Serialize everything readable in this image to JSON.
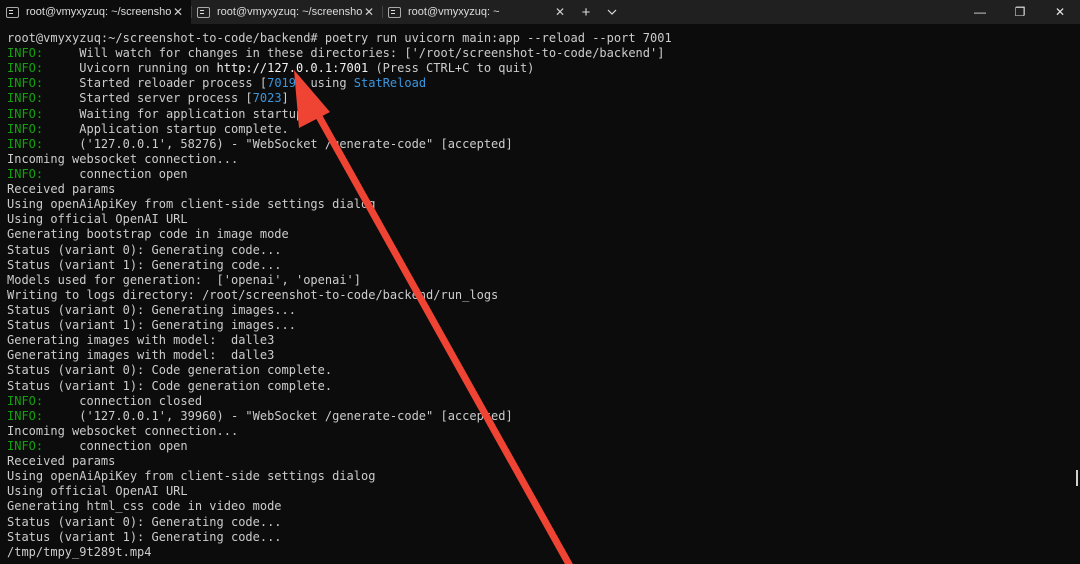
{
  "tabs": [
    {
      "label": "root@vmyxyzuq: ~/screensho",
      "active": true
    },
    {
      "label": "root@vmyxyzuq: ~/screenshot",
      "active": false
    },
    {
      "label": "root@vmyxyzuq: ~",
      "active": false
    }
  ],
  "tab_close_glyph": "✕",
  "new_tab_glyph": "+",
  "dropdown_glyph": "⌄",
  "window_controls": {
    "minimize": "—",
    "maximize": "❐",
    "close": "✕"
  },
  "terminal": {
    "lines": [
      [
        {
          "t": "root@vmyxyzuq:~/screenshot-to-code/backend# poetry run uvicorn main:app --reload --port 7001",
          "c": ""
        }
      ],
      [
        {
          "t": "INFO:",
          "c": "info"
        },
        {
          "t": "     Will watch for changes in these directories: ['/root/screenshot-to-code/backend']",
          "c": ""
        }
      ],
      [
        {
          "t": "INFO:",
          "c": "info"
        },
        {
          "t": "     Uvicorn running on ",
          "c": ""
        },
        {
          "t": "http://127.0.0.1:7001",
          "c": "bright"
        },
        {
          "t": " (Press CTRL+C to quit)",
          "c": ""
        }
      ],
      [
        {
          "t": "INFO:",
          "c": "info"
        },
        {
          "t": "     Started reloader process [",
          "c": ""
        },
        {
          "t": "7019",
          "c": "cyan"
        },
        {
          "t": "] using ",
          "c": ""
        },
        {
          "t": "StatReload",
          "c": "cyan"
        }
      ],
      [
        {
          "t": "INFO:",
          "c": "info"
        },
        {
          "t": "     Started server process [",
          "c": ""
        },
        {
          "t": "7023",
          "c": "cyan"
        },
        {
          "t": "]",
          "c": ""
        }
      ],
      [
        {
          "t": "INFO:",
          "c": "info"
        },
        {
          "t": "     Waiting for application startup.",
          "c": ""
        }
      ],
      [
        {
          "t": "INFO:",
          "c": "info"
        },
        {
          "t": "     Application startup complete.",
          "c": ""
        }
      ],
      [
        {
          "t": "INFO:",
          "c": "info"
        },
        {
          "t": "     ('127.0.0.1', 58276) - \"WebSocket /generate-code\" [accepted]",
          "c": ""
        }
      ],
      [
        {
          "t": "Incoming websocket connection...",
          "c": ""
        }
      ],
      [
        {
          "t": "INFO:",
          "c": "info"
        },
        {
          "t": "     connection open",
          "c": ""
        }
      ],
      [
        {
          "t": "Received params",
          "c": ""
        }
      ],
      [
        {
          "t": "Using openAiApiKey from client-side settings dialog",
          "c": ""
        }
      ],
      [
        {
          "t": "Using official OpenAI URL",
          "c": ""
        }
      ],
      [
        {
          "t": "Generating bootstrap code in image mode",
          "c": ""
        }
      ],
      [
        {
          "t": "Status (variant 0): Generating code...",
          "c": ""
        }
      ],
      [
        {
          "t": "Status (variant 1): Generating code...",
          "c": ""
        }
      ],
      [
        {
          "t": "Models used for generation:  ['openai', 'openai']",
          "c": ""
        }
      ],
      [
        {
          "t": "Writing to logs directory: /root/screenshot-to-code/backend/run_logs",
          "c": ""
        }
      ],
      [
        {
          "t": "Status (variant 0): Generating images...",
          "c": ""
        }
      ],
      [
        {
          "t": "Status (variant 1): Generating images...",
          "c": ""
        }
      ],
      [
        {
          "t": "Generating images with model:  dalle3",
          "c": ""
        }
      ],
      [
        {
          "t": "Generating images with model:  dalle3",
          "c": ""
        }
      ],
      [
        {
          "t": "Status (variant 0): Code generation complete.",
          "c": ""
        }
      ],
      [
        {
          "t": "Status (variant 1): Code generation complete.",
          "c": ""
        }
      ],
      [
        {
          "t": "INFO:",
          "c": "info"
        },
        {
          "t": "     connection closed",
          "c": ""
        }
      ],
      [
        {
          "t": "INFO:",
          "c": "info"
        },
        {
          "t": "     ('127.0.0.1', 39960) - \"WebSocket /generate-code\" [accepted]",
          "c": ""
        }
      ],
      [
        {
          "t": "Incoming websocket connection...",
          "c": ""
        }
      ],
      [
        {
          "t": "INFO:",
          "c": "info"
        },
        {
          "t": "     connection open",
          "c": ""
        }
      ],
      [
        {
          "t": "Received params",
          "c": ""
        }
      ],
      [
        {
          "t": "Using openAiApiKey from client-side settings dialog",
          "c": ""
        }
      ],
      [
        {
          "t": "Using official OpenAI URL",
          "c": ""
        }
      ],
      [
        {
          "t": "Generating html_css code in video mode",
          "c": ""
        }
      ],
      [
        {
          "t": "Status (variant 0): Generating code...",
          "c": ""
        }
      ],
      [
        {
          "t": "Status (variant 1): Generating code...",
          "c": ""
        }
      ],
      [
        {
          "t": "/tmp/tmpy_9t289t.mp4",
          "c": ""
        }
      ]
    ]
  },
  "colors": {
    "background": "#0c0c0c",
    "info": "#13a10e",
    "cyan": "#3a96dd",
    "arrow": "#ef4434"
  }
}
